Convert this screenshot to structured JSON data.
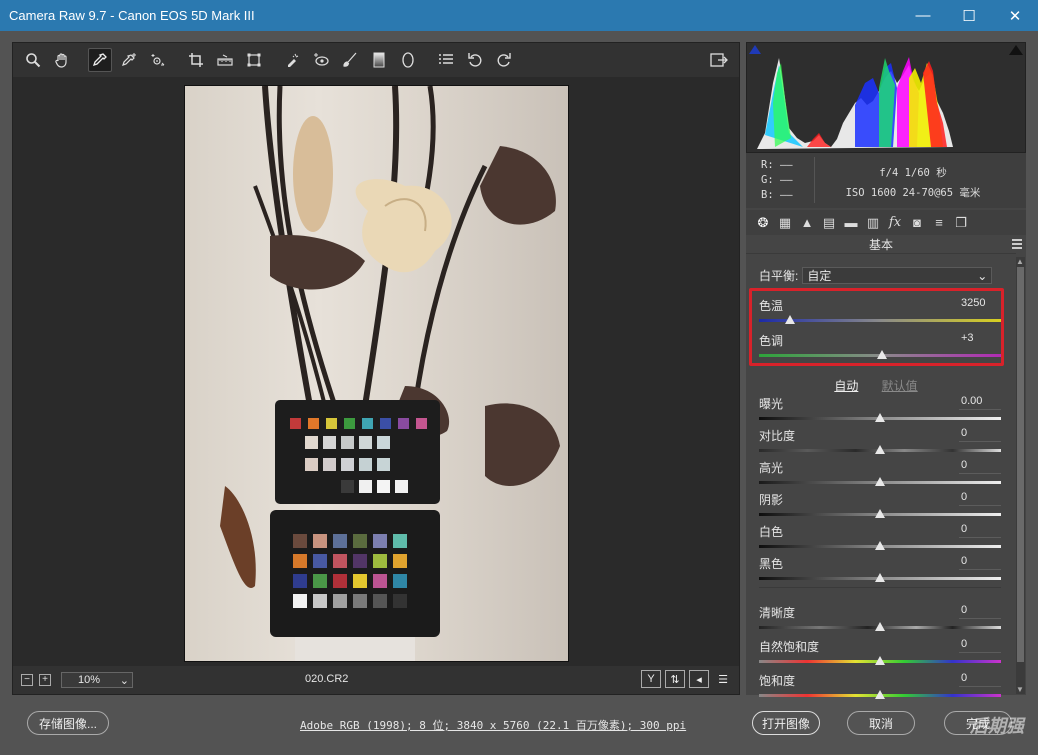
{
  "window": {
    "title": "Camera Raw 9.7 -  Canon EOS 5D Mark III",
    "minimize": "—",
    "maximize": "☐",
    "close": "✕"
  },
  "toolbar": {
    "tools": [
      "zoom-icon",
      "hand-icon",
      "white-balance-icon",
      "color-sampler-icon",
      "targeted-adjust-icon",
      "crop-icon",
      "straighten-icon",
      "transform-icon",
      "spot-removal-icon",
      "red-eye-icon",
      "adjustment-brush-icon",
      "graduated-filter-icon",
      "radial-filter-icon",
      "presets-list-icon",
      "rotate-ccw-icon",
      "rotate-cw-icon"
    ],
    "export_icon": "open-preferences-icon"
  },
  "statusbar": {
    "zoom_value": "10%",
    "filename": "020.CR2",
    "minus": "−",
    "plus": "+"
  },
  "info": {
    "r": "R:  ——",
    "g": "G:  ——",
    "b": "B:  ——",
    "exposure": "f/4   1/60 秒",
    "iso": "ISO 1600   24-70@65 毫米"
  },
  "panel": {
    "title": "基本",
    "white_balance_label": "白平衡:",
    "white_balance_value": "自定",
    "temp_label": "色温",
    "temp_value": "3250",
    "tint_label": "色调",
    "tint_value": "+3",
    "auto_label": "自动",
    "default_label": "默认值",
    "sliders": [
      {
        "label": "曝光",
        "value": "0.00",
        "pos": 0.5
      },
      {
        "label": "对比度",
        "value": "0",
        "pos": 0.5
      },
      {
        "label": "高光",
        "value": "0",
        "pos": 0.5
      },
      {
        "label": "阴影",
        "value": "0",
        "pos": 0.5
      },
      {
        "label": "白色",
        "value": "0",
        "pos": 0.5
      },
      {
        "label": "黑色",
        "value": "0",
        "pos": 0.5
      },
      {
        "label": "清晰度",
        "value": "0",
        "pos": 0.5
      },
      {
        "label": "自然饱和度",
        "value": "0",
        "pos": 0.5
      },
      {
        "label": "饱和度",
        "value": "0",
        "pos": 0.5
      }
    ],
    "temp_pos": 0.13,
    "tint_pos": 0.51
  },
  "bottom": {
    "save_label": "存储图像...",
    "doc_info": "Adobe RGB (1998); 8 位; 3840 x 5760 (22.1 百万像素); 300 ppi",
    "open_label": "打开图像",
    "cancel_label": "取消",
    "done_label": "完成",
    "watermark": "后期强"
  },
  "colors": {
    "titlebar": "#2b79b0",
    "highlight": "#d8222a"
  }
}
